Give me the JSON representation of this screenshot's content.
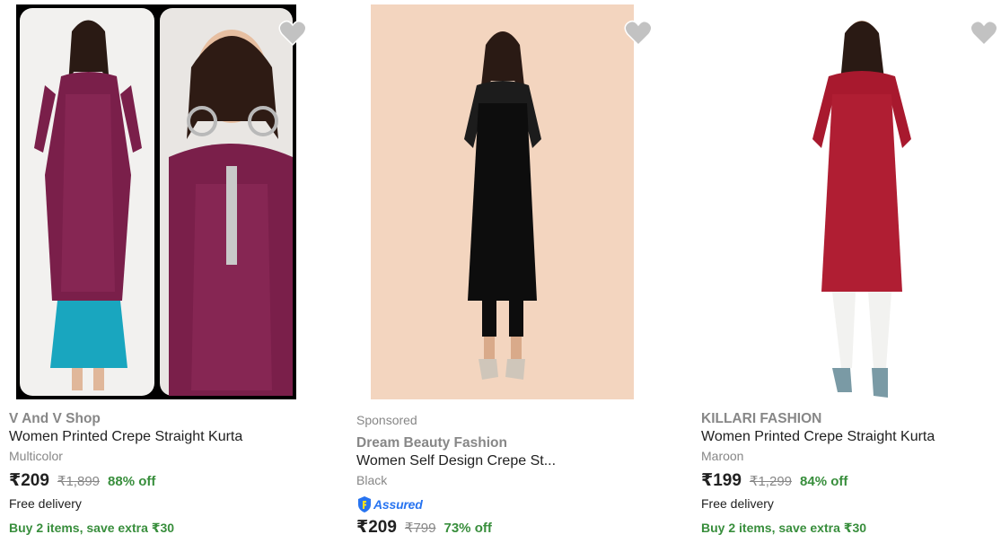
{
  "products": [
    {
      "brand": "V And V Shop",
      "title": "Women Printed Crepe Straight Kurta",
      "variant": "Multicolor",
      "price": "₹209",
      "mrp": "₹1,899",
      "discount": "88% off",
      "delivery": "Free delivery",
      "offer": "Buy 2 items, save extra ₹30",
      "image_desc": "woman in maroon printed kurta with teal palazzo",
      "heart_icon": "heart-icon"
    },
    {
      "sponsored": "Sponsored",
      "brand": "Dream Beauty Fashion",
      "title": "Women Self Design Crepe St...",
      "variant": "Black",
      "assured_label": "Assured",
      "price": "₹209",
      "mrp": "₹799",
      "discount": "73% off",
      "image_desc": "woman in black kurta with lace yoke",
      "heart_icon": "heart-icon"
    },
    {
      "brand": "KILLARI FASHION",
      "title": "Women Printed Crepe Straight Kurta",
      "variant": "Maroon",
      "price": "₹199",
      "mrp": "₹1,299",
      "discount": "84% off",
      "delivery": "Free delivery",
      "offer": "Buy 2 items, save extra ₹30",
      "image_desc": "woman in maroon floral kurta with white leggings",
      "heart_icon": "heart-icon"
    }
  ],
  "colors": {
    "discount_green": "#388e3c",
    "muted_gray": "#878787",
    "assured_blue": "#2874f0",
    "heart_gray": "#c2c2c2"
  }
}
